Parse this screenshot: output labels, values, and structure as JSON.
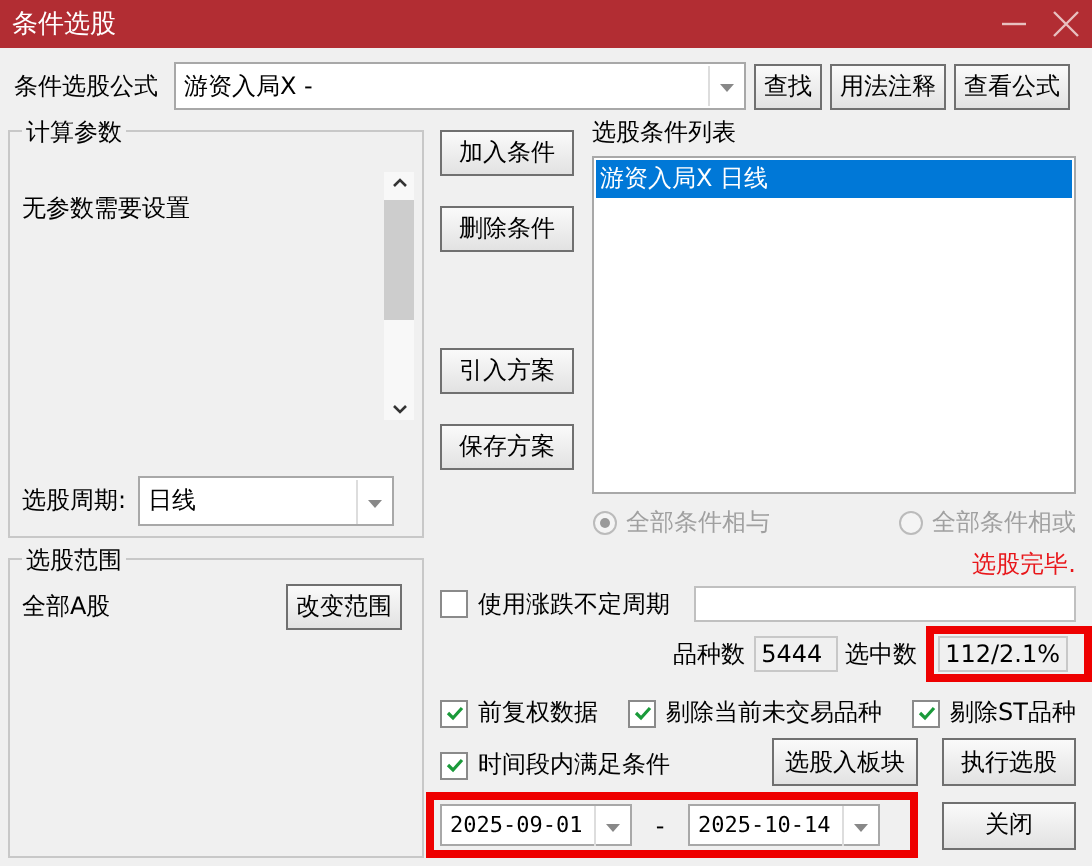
{
  "window": {
    "title": "条件选股"
  },
  "formula": {
    "label": "条件选股公式",
    "value": "游资入局X  -"
  },
  "top_buttons": [
    "查找",
    "用法注释",
    "查看公式"
  ],
  "params_group": {
    "title": "计算参数",
    "message": "无参数需要设置",
    "period_label": "选股周期:",
    "period_value": "日线"
  },
  "middle_button_groups": [
    [
      "加入条件",
      "删除条件"
    ],
    [
      "引入方案",
      "保存方案"
    ]
  ],
  "condition_list": {
    "title": "选股条件列表",
    "items": [
      {
        "label": "游资入局X  日线",
        "selected": true
      }
    ]
  },
  "logic_options": [
    {
      "label": "全部条件相与",
      "selected": true,
      "disabled": true
    },
    {
      "label": "全部条件相或",
      "selected": false,
      "disabled": true
    }
  ],
  "range_group": {
    "title": "选股范围",
    "value": "全部A股",
    "button": "改变范围"
  },
  "status": "选股完毕.",
  "variable_period": {
    "label": "使用涨跌不定周期",
    "checked": false
  },
  "counts": {
    "total_label": "品种数",
    "total": "5444",
    "selected_label": "选中数",
    "selected": "112/2.1%",
    "highlighted": true
  },
  "checkboxes": [
    {
      "label": "前复权数据",
      "checked": true
    },
    {
      "label": "剔除当前未交易品种",
      "checked": true
    },
    {
      "label": "剔除ST品种",
      "checked": true
    }
  ],
  "period_check": {
    "label": "时间段内满足条件",
    "checked": true
  },
  "action_buttons": [
    "选股入板块",
    "执行选股"
  ],
  "date_range": {
    "start": "2025-09-01",
    "separator": "-",
    "end": "2025-10-14",
    "highlighted": true
  },
  "close_button": "关闭"
}
